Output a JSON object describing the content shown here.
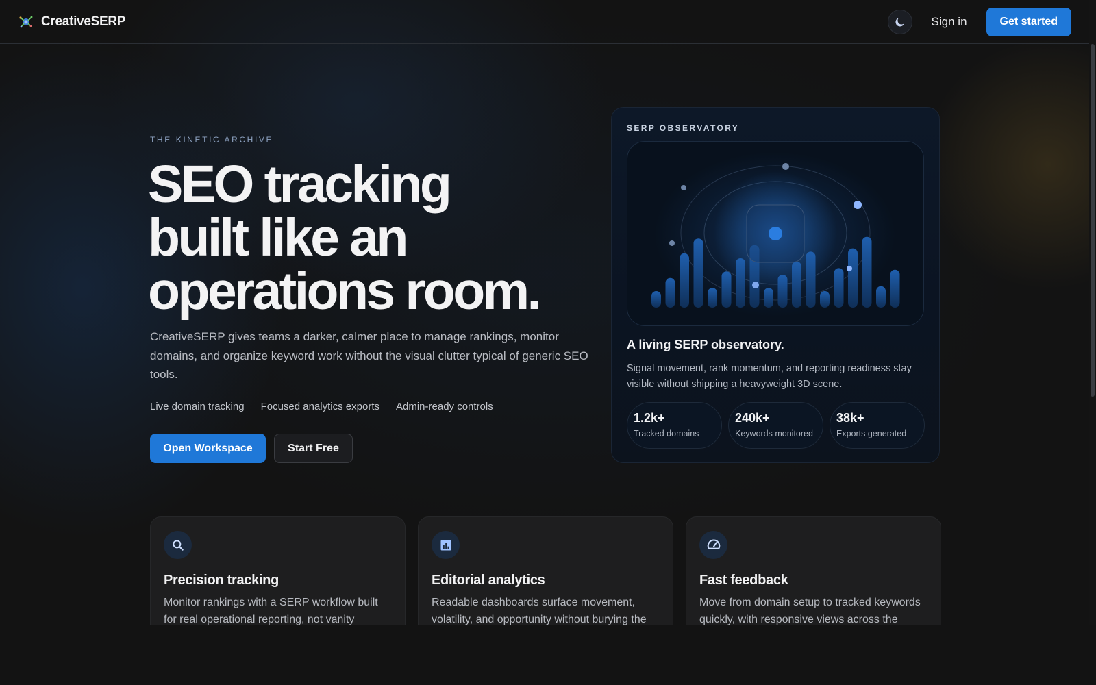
{
  "header": {
    "brand_name": "CreativeSERP",
    "sign_in_label": "Sign in",
    "get_started_label": "Get started"
  },
  "hero": {
    "eyebrow": "THE KINETIC ARCHIVE",
    "headline_lines": [
      "SEO tracking",
      "built like an",
      "operations room."
    ],
    "lede": "CreativeSERP gives teams a darker, calmer place to manage rankings, monitor domains, and organize keyword work without the visual clutter typical of generic SEO tools.",
    "tags": [
      "Live domain tracking",
      "Focused analytics exports",
      "Admin-ready controls"
    ],
    "primary_cta": "Open Workspace",
    "secondary_cta": "Start Free"
  },
  "observatory": {
    "label": "SERP OBSERVATORY",
    "title": "A living SERP observatory.",
    "description": "Signal movement, rank momentum, and reporting readiness stay visible without shipping a heavyweight 3D scene.",
    "stats": [
      {
        "value": "1.2k+",
        "label": "Tracked domains"
      },
      {
        "value": "240k+",
        "label": "Keywords monitored"
      },
      {
        "value": "38k+",
        "label": "Exports generated"
      }
    ],
    "bar_levels": [
      0.1,
      0.18,
      0.33,
      0.42,
      0.12,
      0.22,
      0.3,
      0.38,
      0.12,
      0.2,
      0.28,
      0.34,
      0.1,
      0.24,
      0.36,
      0.43,
      0.13,
      0.23
    ]
  },
  "features": [
    {
      "icon": "search-icon",
      "title": "Precision tracking",
      "description": "Monitor rankings with a SERP workflow built for real operational reporting, not vanity"
    },
    {
      "icon": "chart-icon",
      "title": "Editorial analytics",
      "description": "Readable dashboards surface movement, volatility, and opportunity without burying the"
    },
    {
      "icon": "speedometer-icon",
      "title": "Fast feedback",
      "description": "Move from domain setup to tracked keywords quickly, with responsive views across the"
    }
  ],
  "colors": {
    "accent": "#1f78d8",
    "background": "#131313",
    "card": "#1e1e1f"
  }
}
